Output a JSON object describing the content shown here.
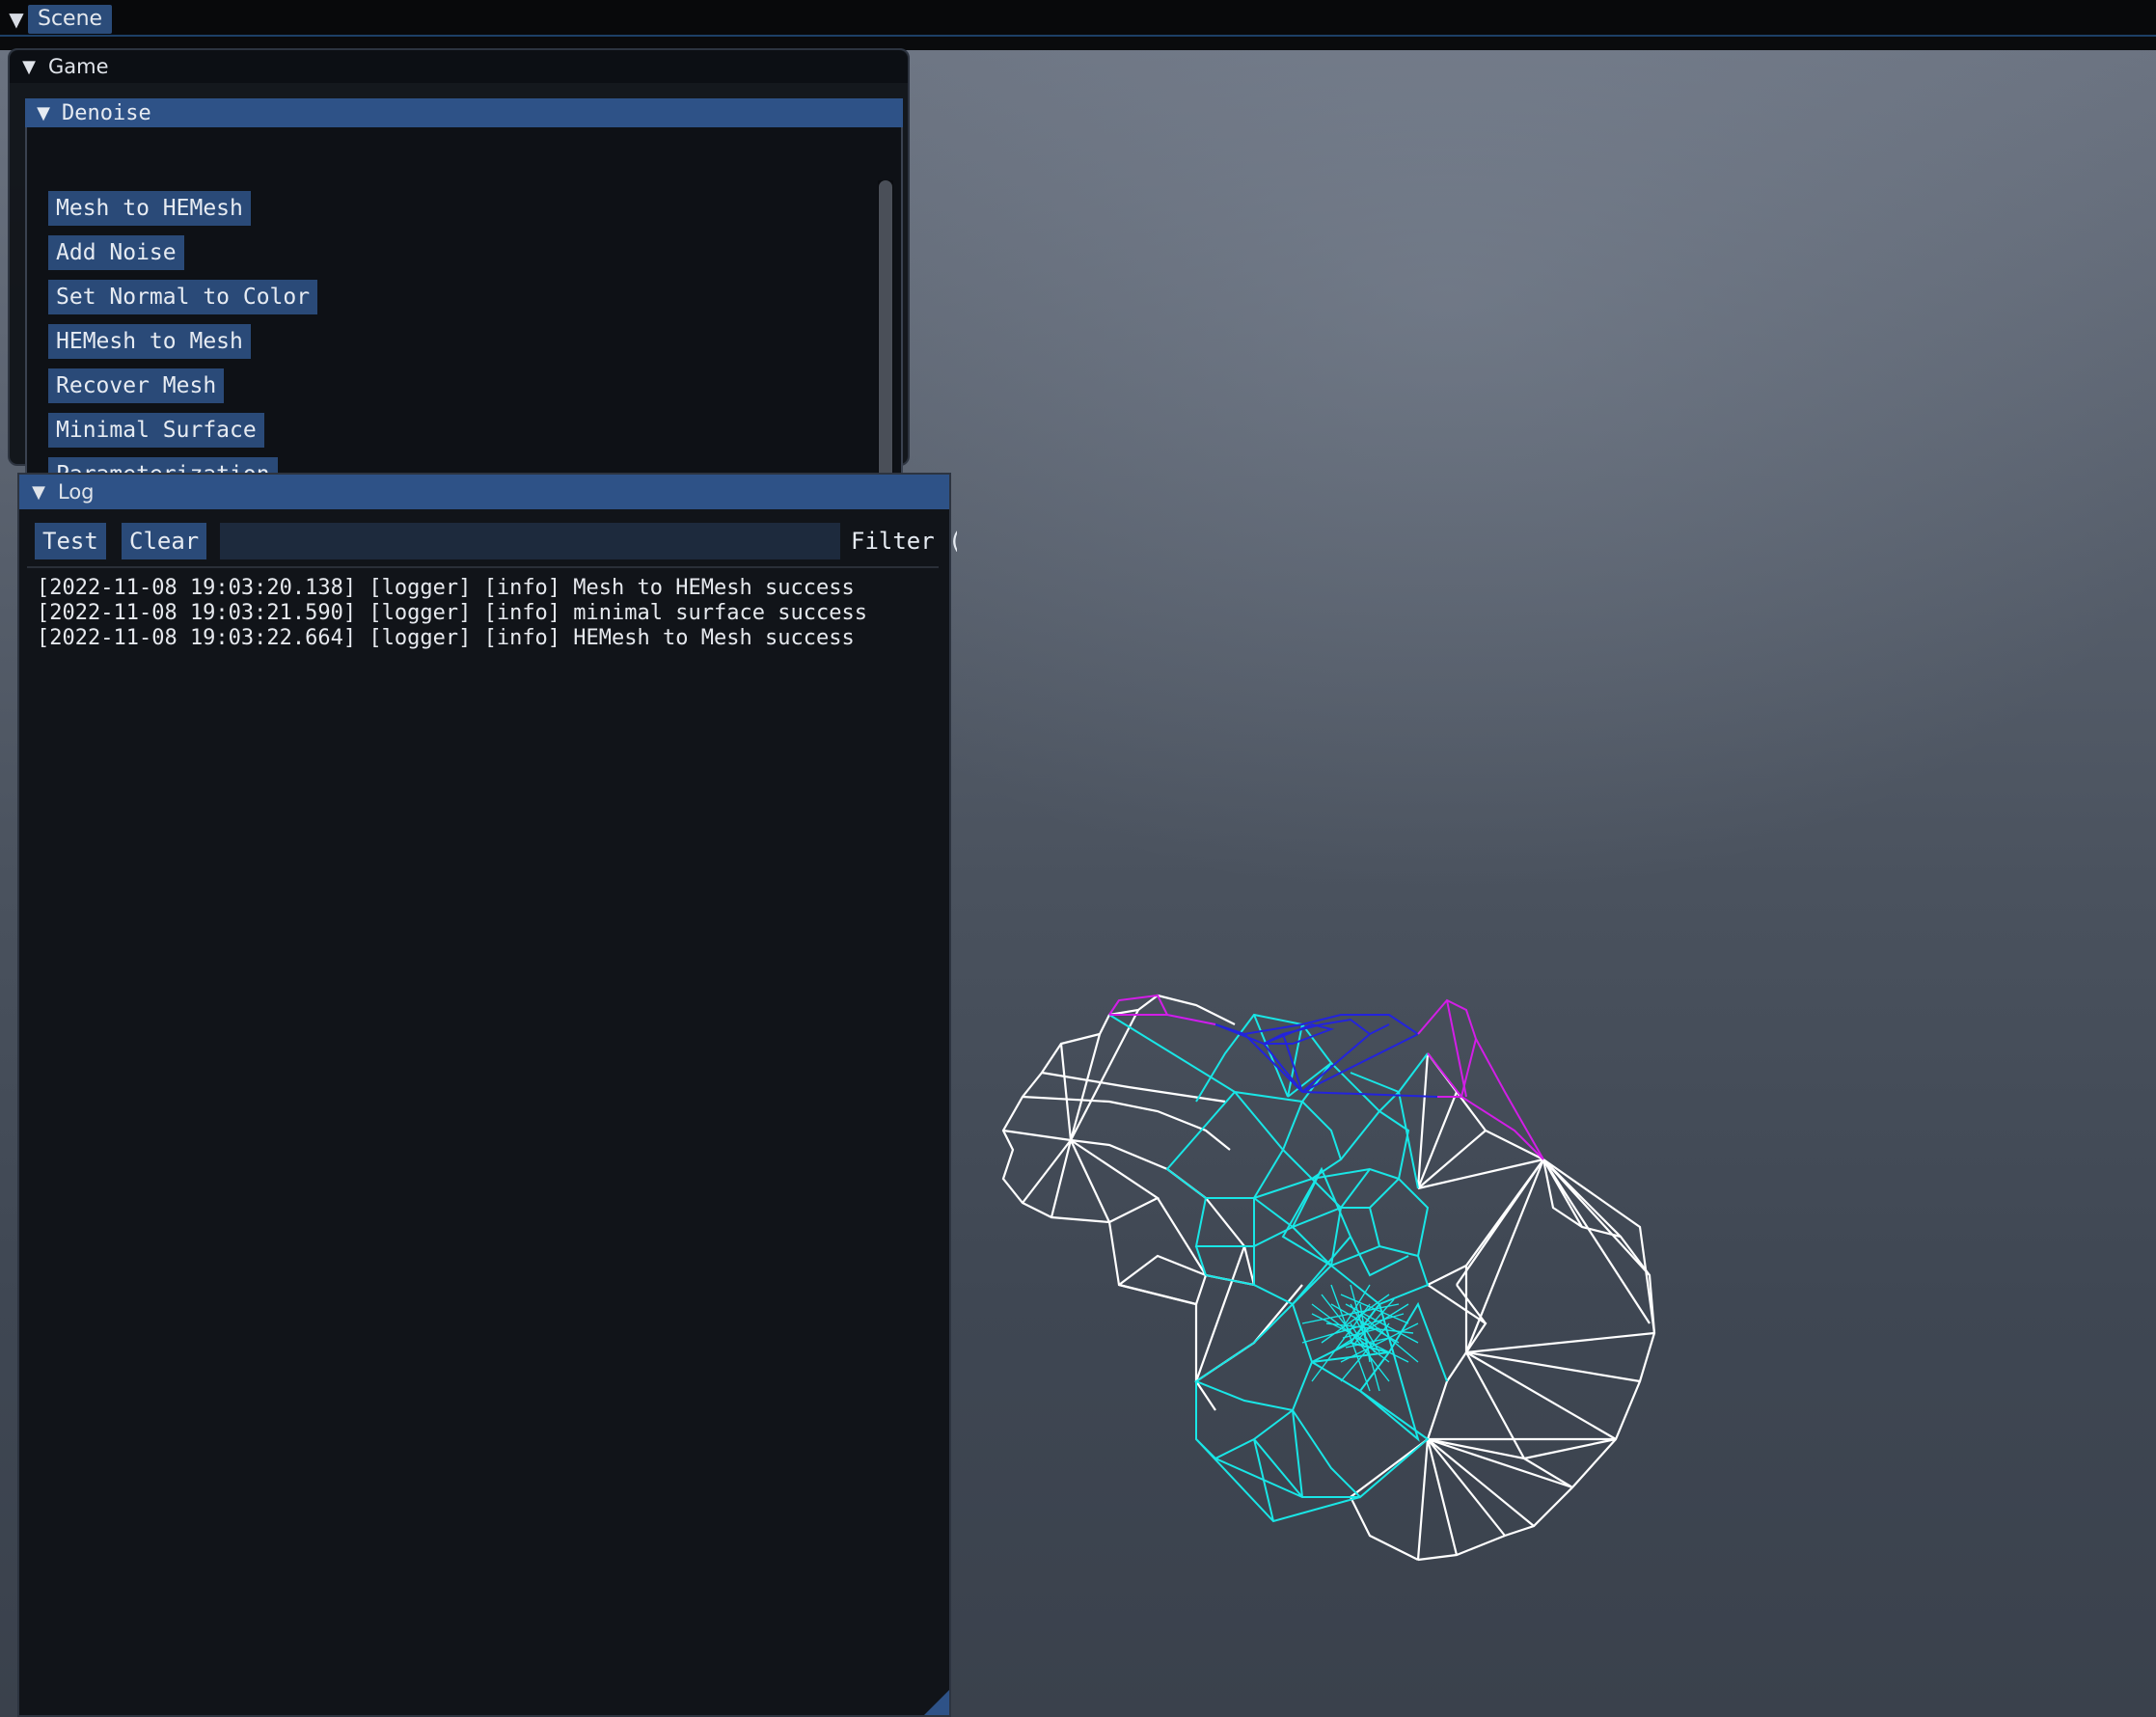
{
  "menubar": {
    "tab_label": "Scene",
    "arrow_icon": "menu-arrow-icon"
  },
  "game_window": {
    "title": "Game",
    "section": {
      "title": "Denoise",
      "buttons": [
        "Mesh to HEMesh",
        "Add Noise",
        "Set Normal to Color",
        "HEMesh to Mesh",
        "Recover Mesh",
        "Minimal Surface",
        "Parameterization"
      ]
    }
  },
  "log_window": {
    "title": "Log",
    "test_label": "Test",
    "clear_label": "Clear",
    "filter_value": "",
    "filter_label": "Filter (\"incl,-excl\") (\"error\")",
    "lines": [
      "[2022-11-08 19:03:20.138] [logger] [info] Mesh to HEMesh success",
      "[2022-11-08 19:03:21.590] [logger] [info] minimal surface success",
      "[2022-11-08 19:03:22.664] [logger] [info] HEMesh to Mesh success"
    ]
  },
  "colors": {
    "accent": "#2e5287",
    "button": "#2a4a78",
    "mesh_white": "#ffffff",
    "mesh_cyan": "#19e6e6",
    "mesh_blue": "#2323dc",
    "mesh_magenta": "#d21ee6"
  }
}
